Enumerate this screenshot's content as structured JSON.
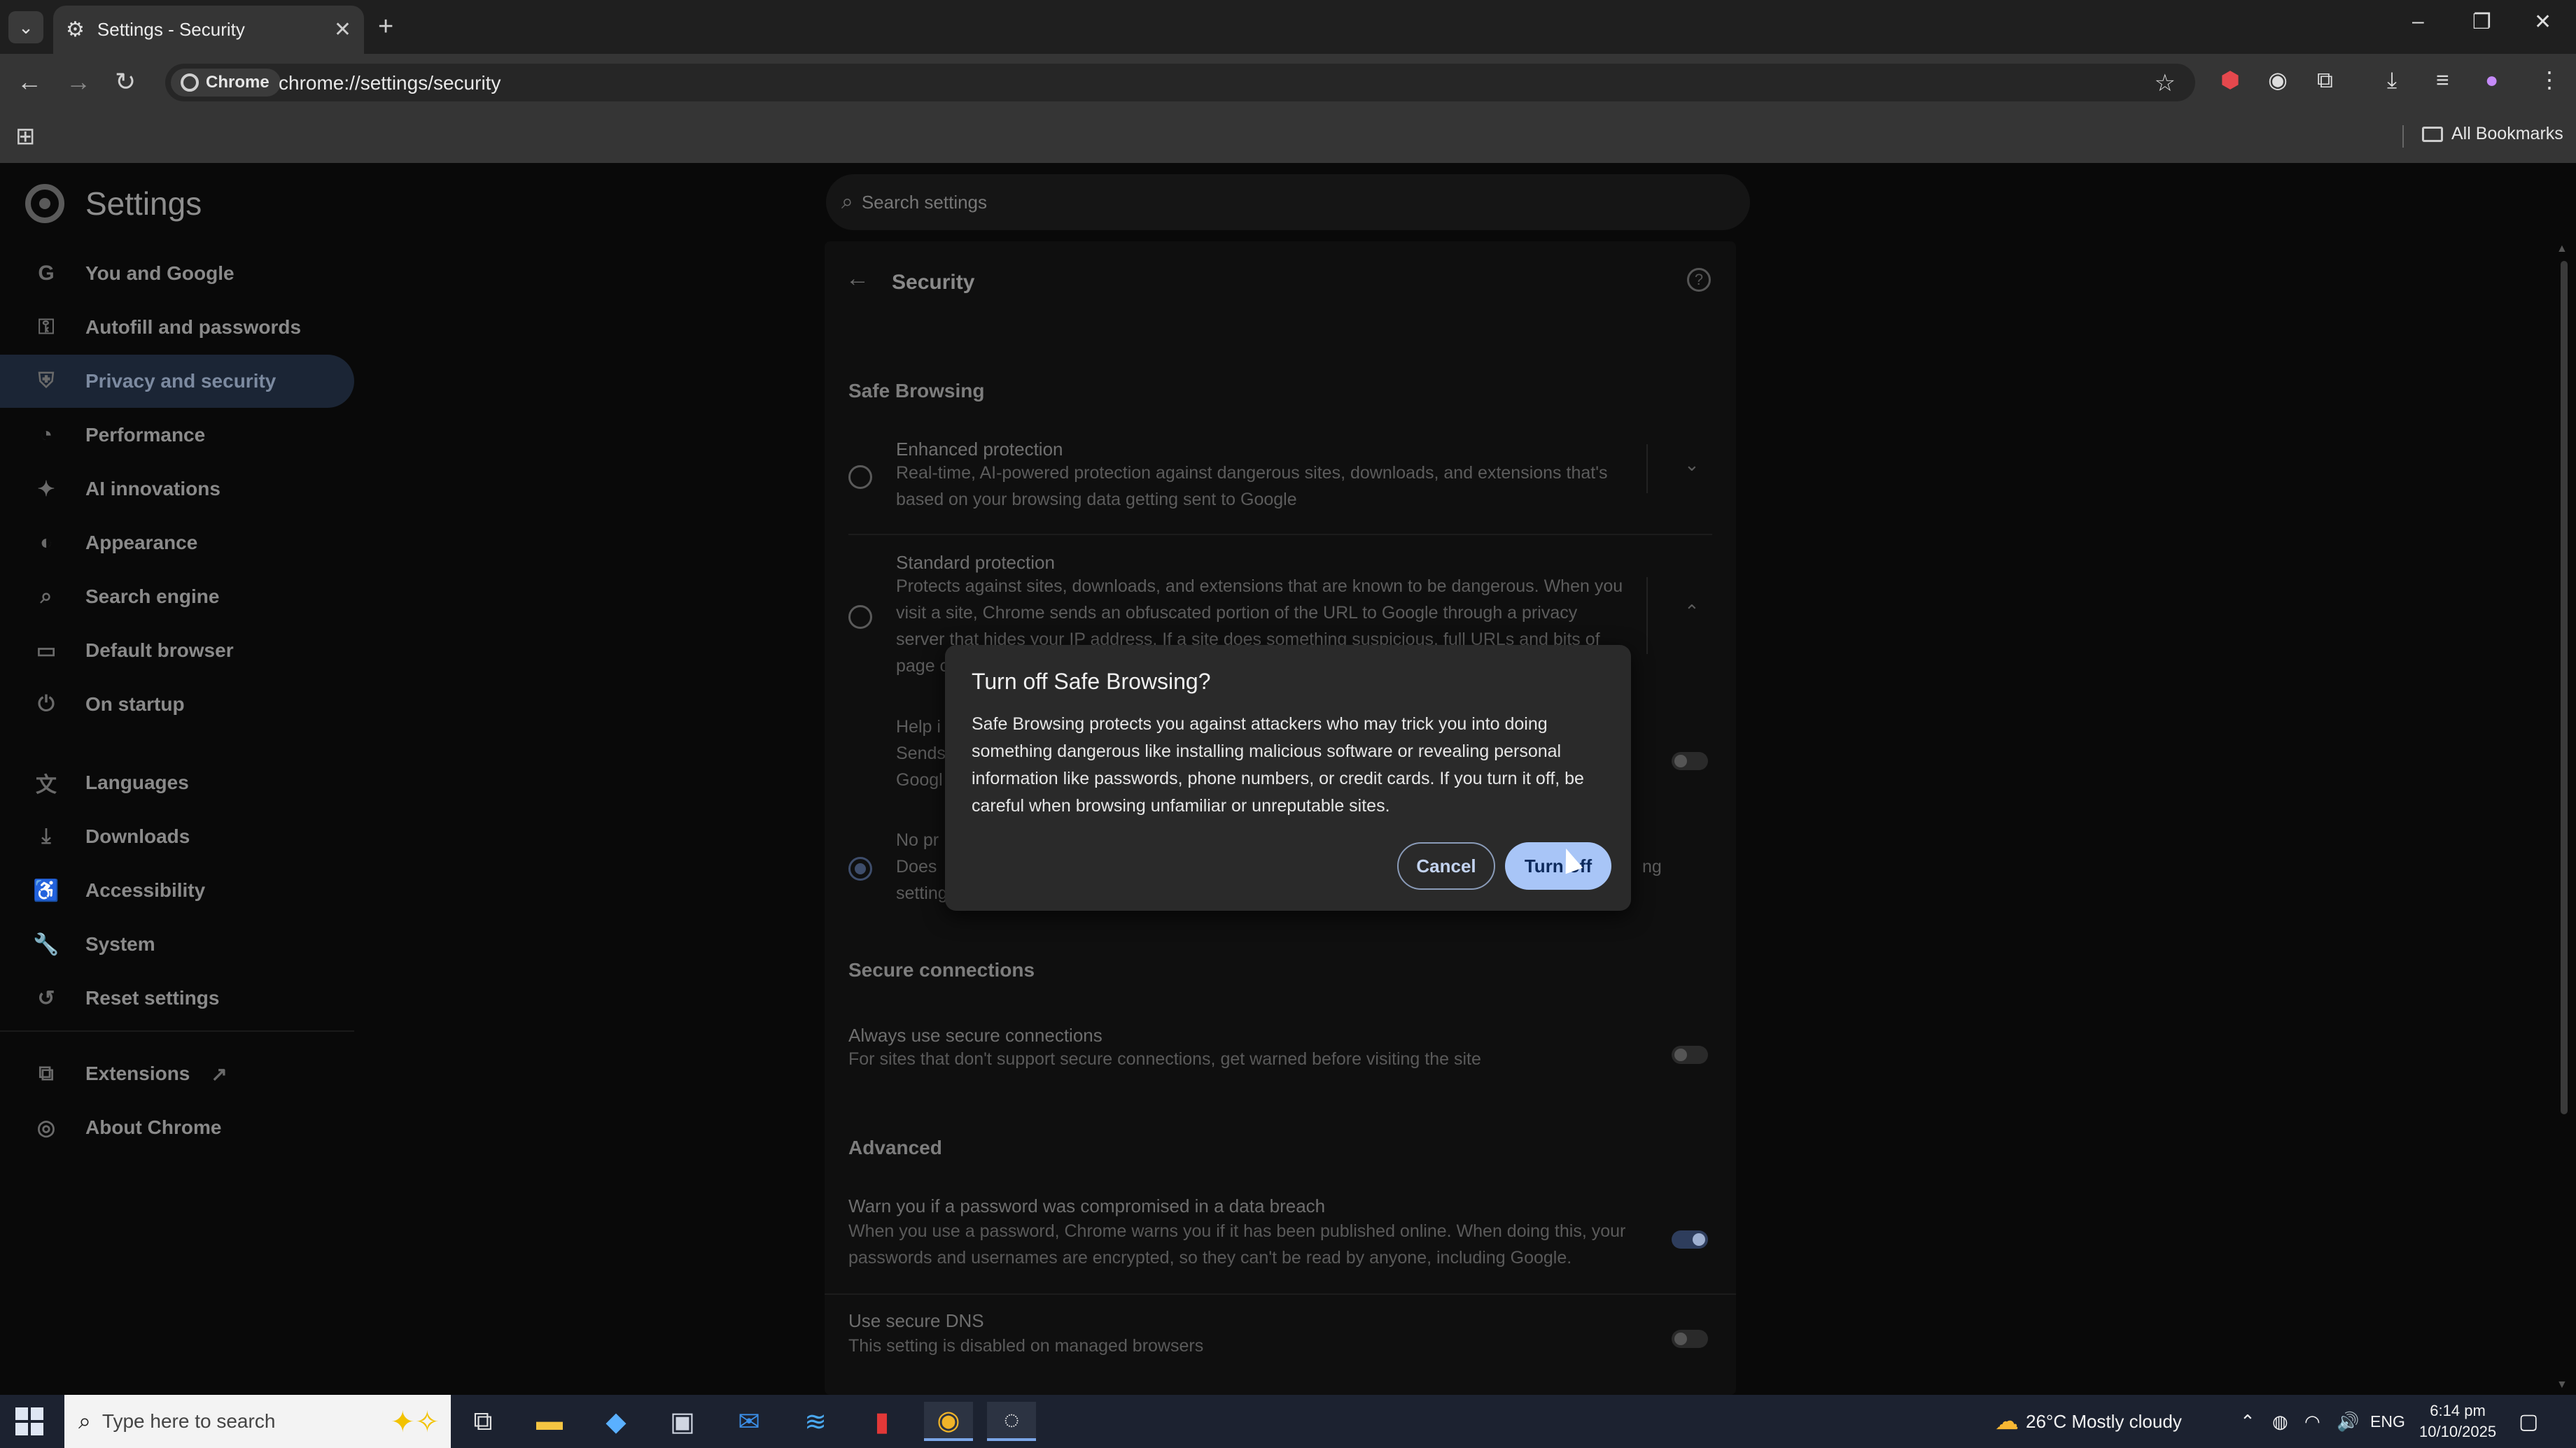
{
  "tab": {
    "title": "Settings - Security",
    "close": "✕"
  },
  "newtab": "+",
  "window": {
    "minimize": "–",
    "maximize": "❐",
    "close": "✕"
  },
  "toolbar": {
    "back": "←",
    "forward": "→",
    "reload": "↻",
    "chip": "Chrome",
    "url": "chrome://settings/security",
    "star": "☆"
  },
  "bookmarks": {
    "all": "All Bookmarks"
  },
  "settings": {
    "title": "Settings",
    "search_placeholder": "Search settings",
    "nav": [
      {
        "label": "You and Google",
        "icon": "G"
      },
      {
        "label": "Autofill and passwords",
        "icon": "⚿"
      },
      {
        "label": "Privacy and security",
        "icon": "⛨"
      },
      {
        "label": "Performance",
        "icon": "◔"
      },
      {
        "label": "AI innovations",
        "icon": "✦"
      },
      {
        "label": "Appearance",
        "icon": "◐"
      },
      {
        "label": "Search engine",
        "icon": "⌕"
      },
      {
        "label": "Default browser",
        "icon": "▭"
      },
      {
        "label": "On startup",
        "icon": "⏻"
      },
      {
        "label": "Languages",
        "icon": "文"
      },
      {
        "label": "Downloads",
        "icon": "⤓"
      },
      {
        "label": "Accessibility",
        "icon": "♿"
      },
      {
        "label": "System",
        "icon": "🔧"
      },
      {
        "label": "Reset settings",
        "icon": "↺"
      },
      {
        "label": "Extensions",
        "icon": "⧉",
        "external": "↗"
      },
      {
        "label": "About Chrome",
        "icon": "◎"
      }
    ]
  },
  "security": {
    "back": "←",
    "title": "Security",
    "help": "?",
    "safe_browsing": "Safe Browsing",
    "enhanced": {
      "title": "Enhanced protection",
      "desc": "Real-time, AI-powered protection against dangerous sites, downloads, and extensions that's based on your browsing data getting sent to Google",
      "chevron": "⌄"
    },
    "standard": {
      "title": "Standard protection",
      "desc": "Protects against sites, downloads, and extensions that are known to be dangerous. When you visit a site, Chrome sends an obfuscated portion of the URL to Google through a privacy server that hides your IP address. If a site does something suspicious, full URLs and bits of page content",
      "chevron": "⌃"
    },
    "partials": {
      "help": "Help i",
      "sends": "Sends",
      "googl": "Googl",
      "no_pr": "No pr",
      "does": "Does",
      "setting": "setting",
      "ng": "ng"
    },
    "secure_connections": "Secure connections",
    "always_https": {
      "title": "Always use secure connections",
      "desc": "For sites that don't support secure connections, get warned before visiting the site"
    },
    "advanced": "Advanced",
    "breach": {
      "title": "Warn you if a password was compromised in a data breach",
      "desc": "When you use a password, Chrome warns you if it has been published online. When doing this, your passwords and usernames are encrypted, so they can't be read by anyone, including Google."
    },
    "dns": {
      "title": "Use secure DNS",
      "desc": "This setting is disabled on managed browsers"
    }
  },
  "dialog": {
    "title": "Turn off Safe Browsing?",
    "body": "Safe Browsing protects you against attackers who may trick you into doing something dangerous like installing malicious software or revealing personal information like passwords, phone numbers, or credit cards. If you turn it off, be careful when browsing unfamiliar or unreputable sites.",
    "cancel": "Cancel",
    "confirm": "Turn off"
  },
  "taskbar": {
    "search_placeholder": "Type here to search",
    "weather": "26°C  Mostly cloudy",
    "lang": "ENG",
    "time": "6:14 pm",
    "date": "10/10/2025"
  },
  "colors": {
    "accent": "#a8c5f7",
    "dialog_bg": "#2a2a2a",
    "taskbar": "#1c2230"
  }
}
